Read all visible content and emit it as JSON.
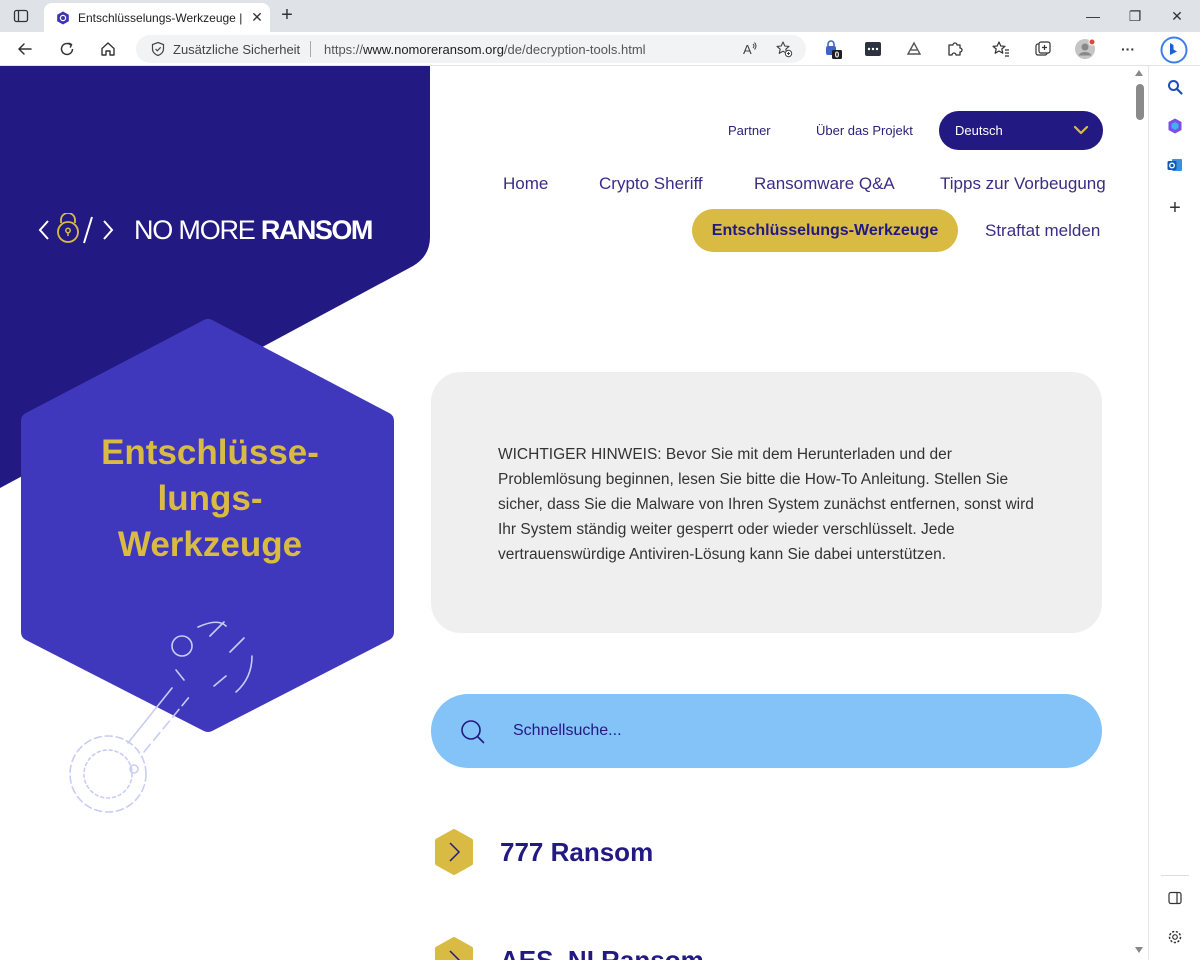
{
  "browser": {
    "tab_title": "Entschlüsselungs-Werkzeuge | Th",
    "tab_close": "✕",
    "new_tab": "+",
    "security_label": "Zusätzliche Sicherheit",
    "url_scheme": "https://",
    "url_host": "www.nomoreransom.org",
    "url_path": "/de/decryption-tools.html",
    "extension_badge": "0",
    "menu_dots": "···",
    "window_minimize": "—",
    "window_restore": "❐",
    "window_close": "✕"
  },
  "site": {
    "logo_light": "NO MORE ",
    "logo_bold": "RANSOM"
  },
  "nav": {
    "partner": "Partner",
    "about": "Über das Projekt",
    "language": "Deutsch",
    "home": "Home",
    "crypto_sheriff": "Crypto Sheriff",
    "ransomware_qa": "Ransomware Q&A",
    "prevention": "Tipps zur Vorbeugung",
    "decryption_tools": "Entschlüsselungs-Werkzeuge",
    "report_crime": "Straftat melden"
  },
  "hero": {
    "title_line1": "Entschlüsse-",
    "title_line2": "lungs-",
    "title_line3": "Werkzeuge"
  },
  "notice": {
    "text": "WICHTIGER HINWEIS: Bevor Sie mit dem Herunterladen und der Problemlösung beginnen, lesen Sie bitte die How-To Anleitung. Stellen Sie sicher, dass Sie die Malware von Ihren System zunächst entfernen, sonst wird Ihr System ständig weiter gesperrt oder wieder verschlüsselt. Jede vertrauenswürdige Antiviren-Lösung kann Sie dabei unterstützen."
  },
  "search": {
    "placeholder": "Schnellsuche..."
  },
  "tools": [
    {
      "name": "777 Ransom"
    },
    {
      "name": "AES_NI Ransom"
    }
  ],
  "colors": {
    "navy": "#231982",
    "violet": "#4038bc",
    "gold": "#d9bb44",
    "light_blue": "#83c3f7",
    "notice_gray": "#efefef"
  },
  "icons": {
    "tab_menu": "tab-actions-icon",
    "favicon": "nomoreransom-favicon",
    "back": "back-arrow-icon",
    "reload": "reload-icon",
    "home": "home-icon",
    "shield": "shield-icon",
    "read_aloud": "read-aloud-icon",
    "favorite_add": "star-add-icon",
    "search": "search-icon",
    "expand": "chevron-right-icon"
  }
}
